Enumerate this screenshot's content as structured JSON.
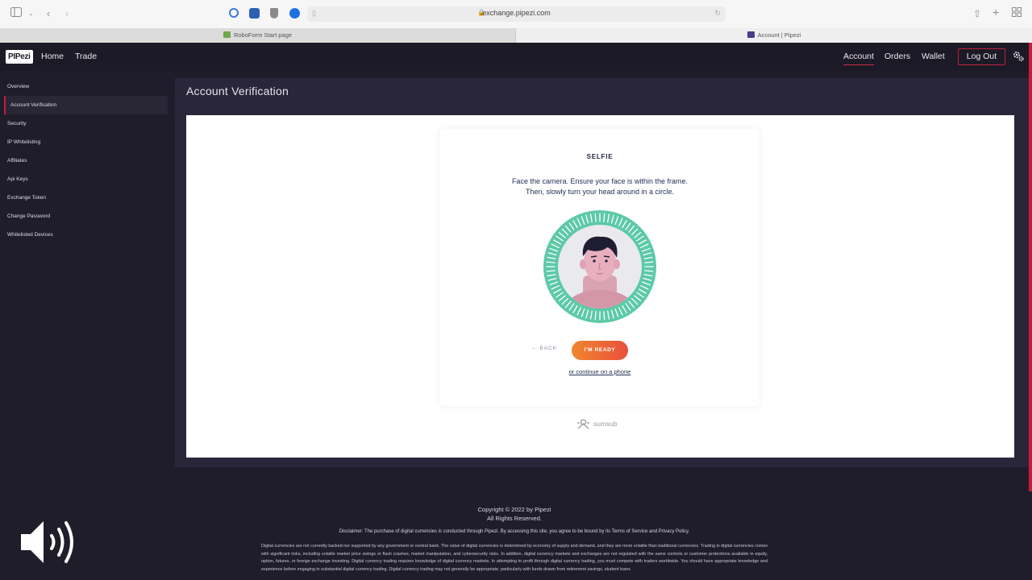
{
  "browser": {
    "url": "exchange.pipezi.com",
    "tabs": [
      {
        "label": "RoboForm Start page",
        "active": false
      },
      {
        "label": "Account | Pipezi",
        "active": true
      }
    ]
  },
  "nav": {
    "logo": "PIPezi",
    "left_links": [
      "Home",
      "Trade"
    ],
    "right_links": [
      "Account",
      "Orders",
      "Wallet"
    ],
    "active_link": "Account",
    "logout": "Log Out"
  },
  "sidebar": {
    "items": [
      {
        "label": "Overview"
      },
      {
        "label": "Account Verification",
        "active": true
      },
      {
        "label": "Security"
      },
      {
        "label": "IP Whitelisting"
      },
      {
        "label": "Affiliates"
      },
      {
        "label": "Api Keys"
      },
      {
        "label": "Exchange Token"
      },
      {
        "label": "Change Password"
      },
      {
        "label": "Whitelisted Devices"
      }
    ]
  },
  "main": {
    "title": "Account Verification",
    "card": {
      "title": "SELFIE",
      "instruction_line1": "Face the camera. Ensure your face is within the frame.",
      "instruction_line2": "Then, slowly turn your head around in a circle.",
      "back_label": "BACK",
      "ready_label": "I'M READY",
      "phone_link": "or continue on a phone"
    },
    "provider": "sumsub"
  },
  "footer": {
    "copyright": "Copyright © 2022 by Pipezi",
    "rights": "All Rights Reserved.",
    "disclaimer": "Disclaimer: The purchase of digital currencies is conducted through Pipezi. By accessing this site, you agree to be bound by its Terms of Service and Privacy Policy.",
    "legal": "Digital currencies are not currently backed nor supported by any government or central bank. The value of digital currencies is determined by economy of supply and demand, and they are more volatile than traditional currencies. Trading in digital currencies comes with significant risks, including volatile market price swings or flash crashes, market manipulation, and cybersecurity risks. In addition, digital currency markets and exchanges are not regulated with the same controls or customer protections available in equity, option, futures, or foreign exchange investing. Digital currency trading requires knowledge of digital currency markets. In attempting to profit through digital currency trading, you must compete with traders worldwide. You should have appropriate knowledge and experience before engaging in substantial digital currency trading. Digital currency trading may not generally be appropriate, particularly with funds drawn from retirement savings, student loans"
  },
  "colors": {
    "accent": "#c21f3d",
    "nav_bg": "#1c1a26",
    "panel_bg": "#29263a",
    "ready_gradient_start": "#f0862f",
    "ready_gradient_end": "#e9503c",
    "ring": "#5cc9a7"
  },
  "icons": {
    "sidebar_toggle": "sidebar-icon",
    "back": "chevron-left-icon",
    "forward": "chevron-right-icon",
    "settings": "gear-icon",
    "share": "share-icon",
    "new_tab": "plus-icon",
    "tab_overview": "grid-icon",
    "volume": "speaker-icon"
  }
}
